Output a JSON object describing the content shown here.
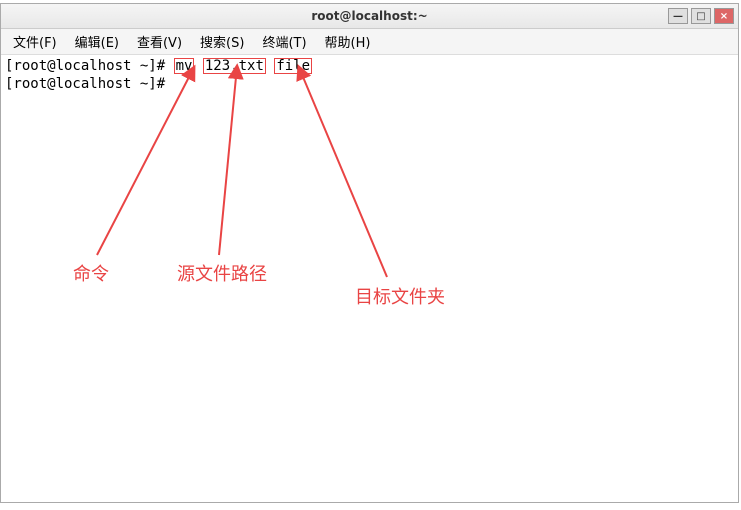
{
  "title": "root@localhost:~",
  "menu": {
    "file": "文件(F)",
    "edit": "编辑(E)",
    "view": "查看(V)",
    "search": "搜索(S)",
    "terminal": "终端(T)",
    "help": "帮助(H)"
  },
  "term": {
    "prompt": "[root@localhost ~]# ",
    "cmd": "mv",
    "src": "123.txt",
    "dst": "file",
    "prompt2": "[root@localhost ~]# "
  },
  "controls": {
    "minimize": "—",
    "maximize": "□",
    "close": "×"
  },
  "annotations": {
    "cmd": "命令",
    "src": "源文件路径",
    "dst": "目标文件夹"
  }
}
